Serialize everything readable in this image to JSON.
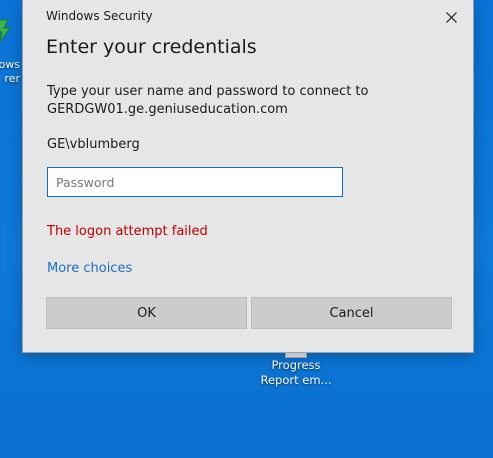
{
  "desktop": {
    "left_icon_label_line1": "ows",
    "left_icon_label_line2": "rer",
    "mid_icon_label_line1": "Progress",
    "mid_icon_label_line2": "Report em..."
  },
  "dialog": {
    "window_title": "Windows Security",
    "heading": "Enter your credentials",
    "description_line1": "Type your user name and password to connect to",
    "description_line2": "GERDGW01.ge.geniuseducation.com",
    "username": "GE\\vblumberg",
    "password_placeholder": "Password",
    "password_value": "",
    "error_message": "The logon attempt failed",
    "more_choices_label": "More choices",
    "ok_label": "OK",
    "cancel_label": "Cancel"
  },
  "colors": {
    "desktop_blue": "#0a73d6",
    "dialog_bg": "#e6e6e6",
    "error_red": "#c00000",
    "link_blue": "#1a6fc9",
    "button_gray": "#cccccc"
  }
}
